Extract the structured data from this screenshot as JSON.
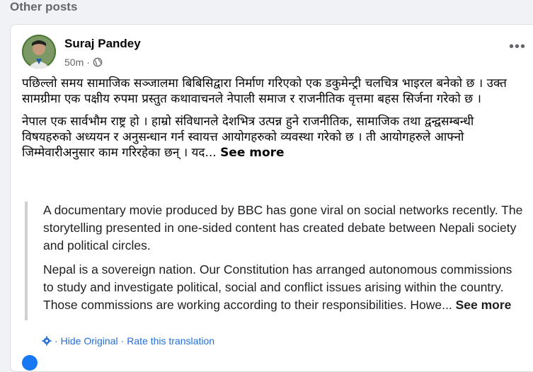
{
  "section": {
    "title": "Other posts"
  },
  "post": {
    "author": "Suraj Pandey",
    "time": "50m",
    "dot": "·",
    "options_glyph": "•••",
    "paragraph1": "पछिल्लो समय सामाजिक सञ्जालमा बिबिसिद्वारा निर्माण गरिएको एक डकुमेन्ट्री चलचित्र भाइरल बनेको छ । उक्त सामग्रीमा एक पक्षीय रुपमा प्रस्तुत कथावाचनले नेपाली समाज र राजनीतिक वृत्तमा बहस सिर्जना गरेको छ ।",
    "paragraph2": "नेपाल एक सार्वभौम राष्ट्र हो । हाम्रो संविधानले देशभित्र उत्पन्न हुने राजनीतिक, सामाजिक तथा द्वन्द्वसम्बन्धी विषयहरुको अध्ययन र अनुसन्धान गर्न स्वायत्त आयोगहरुको व्यवस्था गरेको छ । ती आयोगहरुले आफ्नो जिम्मेवारीअनुसार काम गरिरहेका छन् । यद...",
    "see_more": "See more"
  },
  "translation": {
    "paragraph1": "A documentary movie produced by BBC has gone viral on social networks recently. The storytelling presented in one-sided content has created debate between Nepali society and political circles.",
    "paragraph2": "Nepal is a sovereign nation. Our Constitution has arranged autonomous commissions to study and investigate political, social and conflict issues arising within the country. Those commissions are working according to their responsibilities. Howe...",
    "see_more": "See more",
    "hide_original": "Hide Original",
    "separator": "·",
    "rate": "Rate this translation"
  },
  "icons": {
    "globe": "globe-icon",
    "options": "more-options-icon",
    "translate": "gear-icon"
  },
  "colors": {
    "link": "#216fdb",
    "secondary_text": "#65676b",
    "background": "#f0f2f5"
  }
}
